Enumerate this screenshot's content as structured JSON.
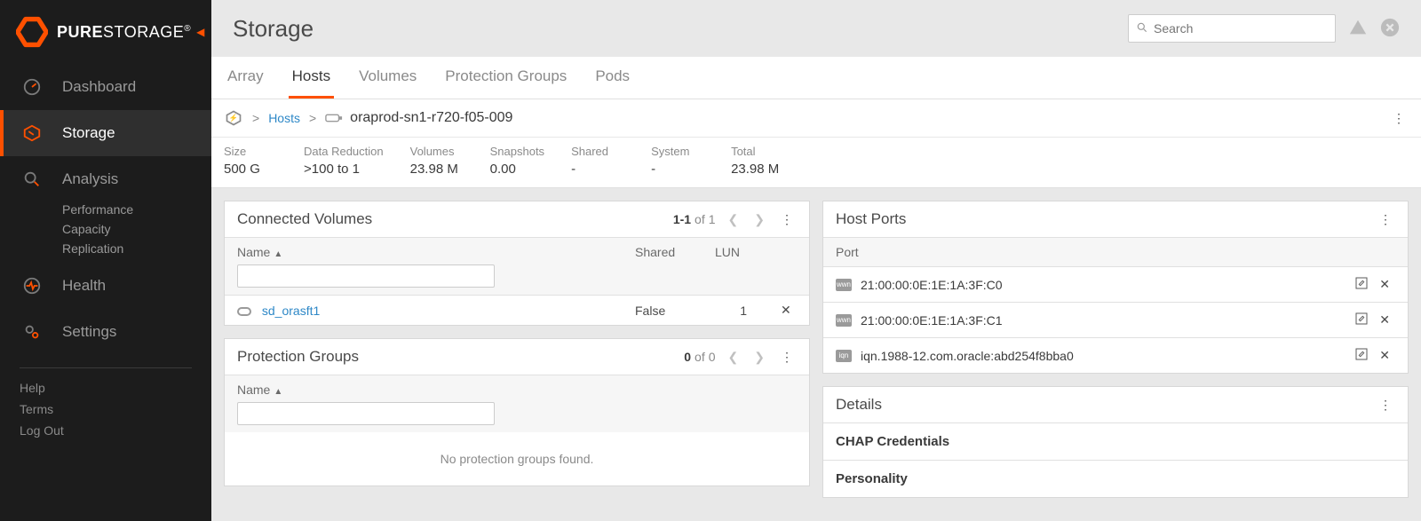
{
  "brand": {
    "bold": "PURE",
    "rest": "STORAGE",
    "tm": "®"
  },
  "sidebar": {
    "items": [
      {
        "label": "Dashboard"
      },
      {
        "label": "Storage"
      },
      {
        "label": "Analysis"
      },
      {
        "label": "Health"
      },
      {
        "label": "Settings"
      }
    ],
    "analysis_sub": [
      {
        "label": "Performance"
      },
      {
        "label": "Capacity"
      },
      {
        "label": "Replication"
      }
    ],
    "footer": [
      {
        "label": "Help"
      },
      {
        "label": "Terms"
      },
      {
        "label": "Log Out"
      }
    ]
  },
  "page_title": "Storage",
  "search": {
    "placeholder": "Search"
  },
  "tabs": [
    {
      "label": "Array"
    },
    {
      "label": "Hosts"
    },
    {
      "label": "Volumes"
    },
    {
      "label": "Protection Groups"
    },
    {
      "label": "Pods"
    }
  ],
  "breadcrumb": {
    "hosts_label": "Hosts",
    "host_name": "oraprod-sn1-r720-f05-009"
  },
  "stats": [
    {
      "label": "Size",
      "value": "500 G"
    },
    {
      "label": "Data Reduction",
      "value": ">100 to 1"
    },
    {
      "label": "Volumes",
      "value": "23.98 M"
    },
    {
      "label": "Snapshots",
      "value": "0.00"
    },
    {
      "label": "Shared",
      "value": "-"
    },
    {
      "label": "System",
      "value": "-"
    },
    {
      "label": "Total",
      "value": "23.98 M"
    }
  ],
  "connected_volumes": {
    "title": "Connected Volumes",
    "paging": {
      "range": "1-1",
      "of_word": " of ",
      "total": "1"
    },
    "columns": {
      "name": "Name",
      "shared": "Shared",
      "lun": "LUN"
    },
    "rows": [
      {
        "name": "sd_orasft1",
        "shared": "False",
        "lun": "1"
      }
    ]
  },
  "protection_groups": {
    "title": "Protection Groups",
    "paging": {
      "range": "0",
      "of_word": " of ",
      "total": "0"
    },
    "columns": {
      "name": "Name"
    },
    "empty": "No protection groups found."
  },
  "host_ports": {
    "title": "Host Ports",
    "column": "Port",
    "rows": [
      {
        "label": "21:00:00:0E:1E:1A:3F:C0"
      },
      {
        "label": "21:00:00:0E:1E:1A:3F:C1"
      },
      {
        "label": "iqn.1988-12.com.oracle:abd254f8bba0"
      }
    ]
  },
  "details": {
    "title": "Details",
    "rows": [
      {
        "label": "CHAP Credentials"
      },
      {
        "label": "Personality"
      }
    ]
  }
}
